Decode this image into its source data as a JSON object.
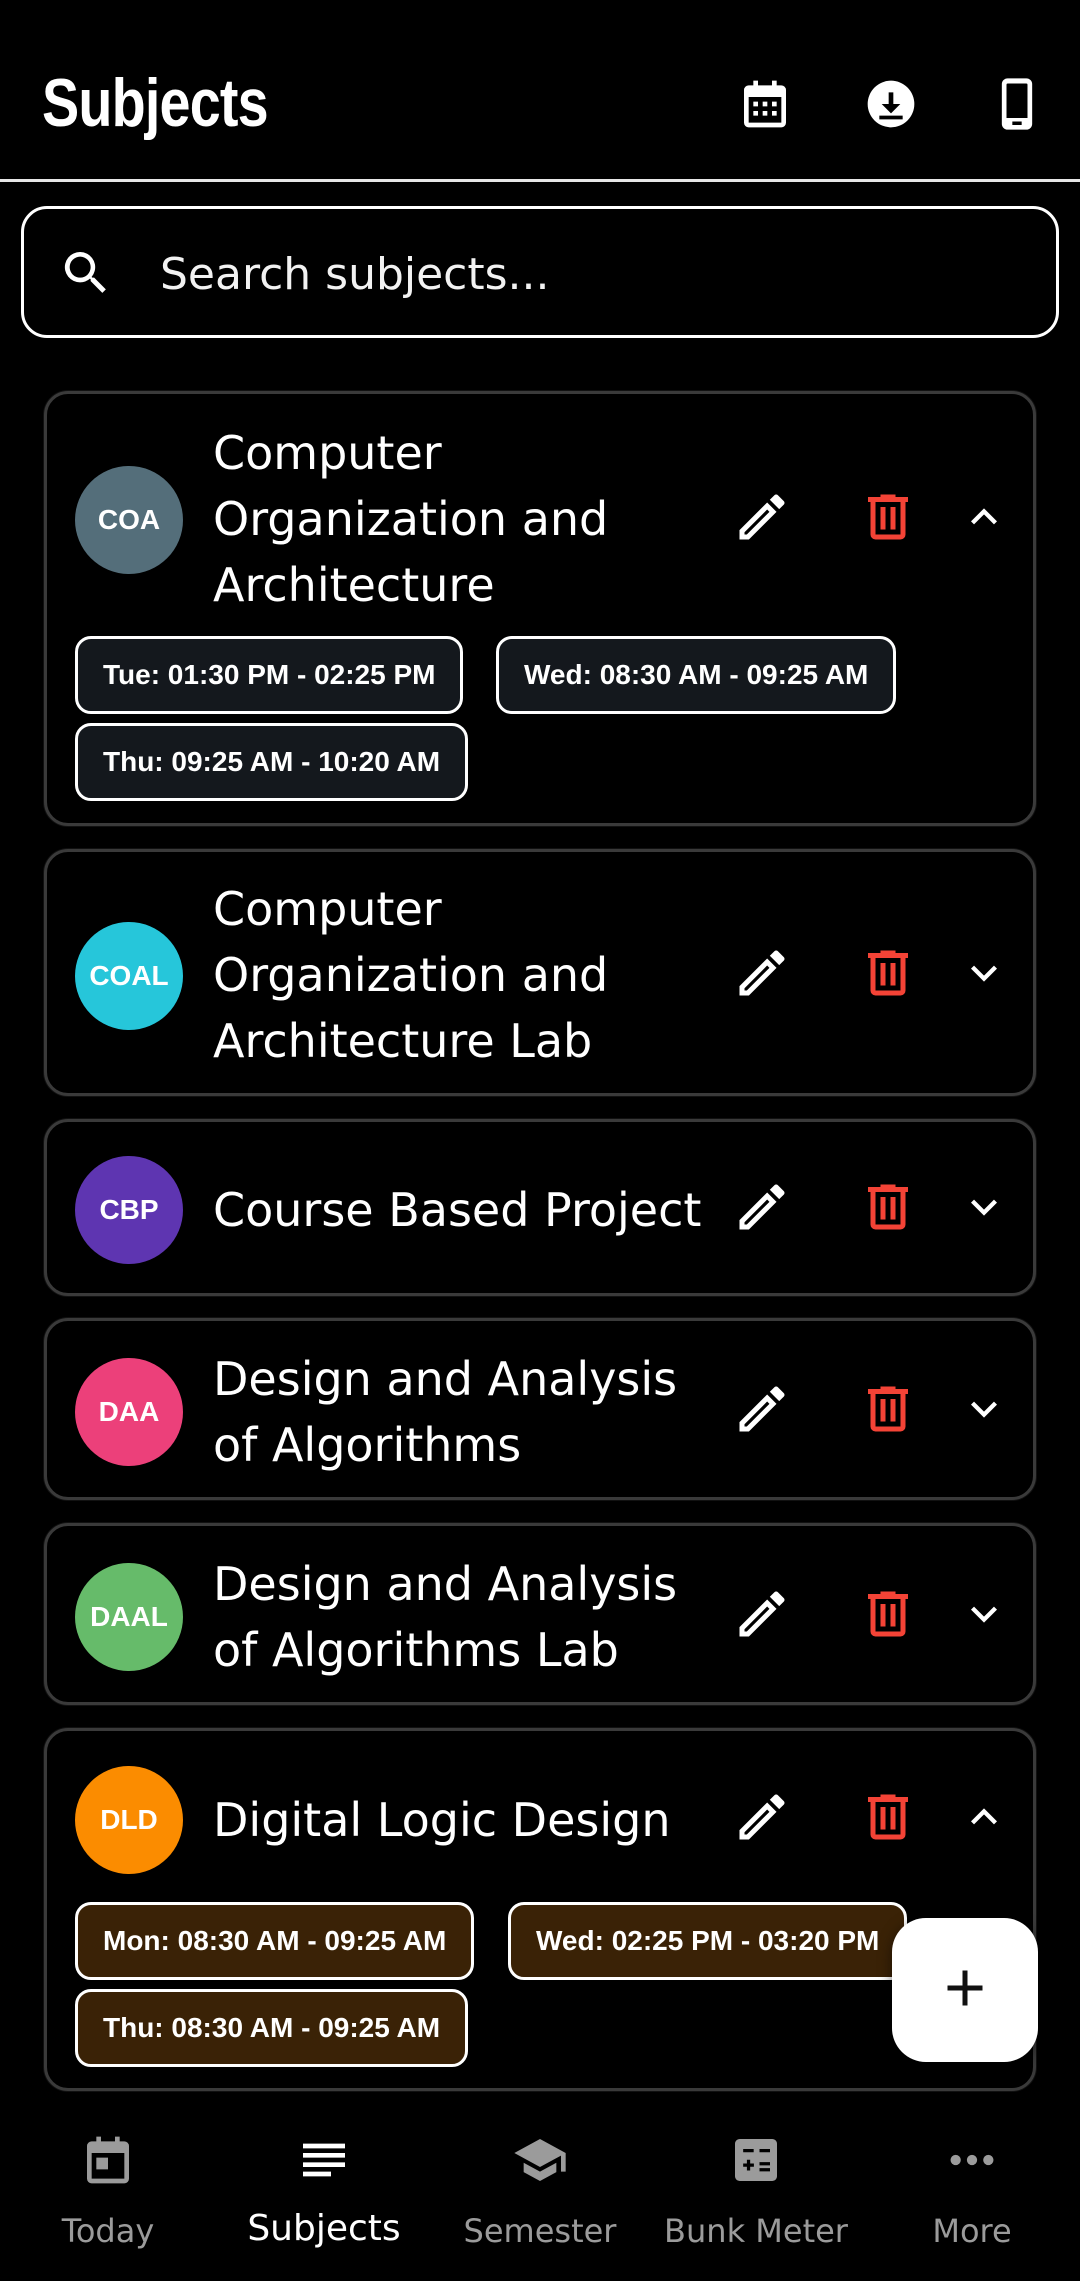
{
  "header": {
    "title": "Subjects",
    "actions": [
      {
        "icon": "calendar-icon"
      },
      {
        "icon": "download-icon"
      },
      {
        "icon": "phone-icon"
      }
    ]
  },
  "search": {
    "placeholder": "Search subjects...",
    "value": ""
  },
  "subjects": [
    {
      "abbr": "COA",
      "name": "Computer Organization and Architecture",
      "color": "#546e7a",
      "expanded": true,
      "chip_style": "dark",
      "slots": [
        "Tue: 01:30 PM - 02:25 PM",
        "Wed: 08:30 AM - 09:25 AM",
        "Thu: 09:25 AM - 10:20 AM"
      ]
    },
    {
      "abbr": "COAL",
      "name": "Computer Organization and Architecture Lab",
      "color": "#26c6da",
      "expanded": false
    },
    {
      "abbr": "CBP",
      "name": "Course Based Project",
      "color": "#5e35b1",
      "expanded": false
    },
    {
      "abbr": "DAA",
      "name": "Design and Analysis of Algorithms",
      "color": "#ec407a",
      "expanded": false
    },
    {
      "abbr": "DAAL",
      "name": "Design and Analysis of Algorithms Lab",
      "color": "#66bb6a",
      "expanded": false
    },
    {
      "abbr": "DLD",
      "name": "Digital Logic Design",
      "color": "#fb8c00",
      "expanded": true,
      "chip_style": "brown",
      "slots": [
        "Mon: 08:30 AM - 09:25 AM",
        "Wed: 02:25 PM - 03:20 PM",
        "Thu: 08:30 AM - 09:25 AM"
      ]
    }
  ],
  "fab": {
    "icon": "plus-icon"
  },
  "nav": {
    "active": "Subjects",
    "items": [
      {
        "label": "Today",
        "icon": "calendar-day-icon"
      },
      {
        "label": "Subjects",
        "icon": "list-icon"
      },
      {
        "label": "Semester",
        "icon": "graduation-cap-icon"
      },
      {
        "label": "Bunk Meter",
        "icon": "calculator-icon"
      },
      {
        "label": "More",
        "icon": "more-horizontal-icon"
      }
    ]
  },
  "colors": {
    "background": "#000000",
    "delete": "#f44336",
    "inactive_nav": "#9b9b9b"
  }
}
